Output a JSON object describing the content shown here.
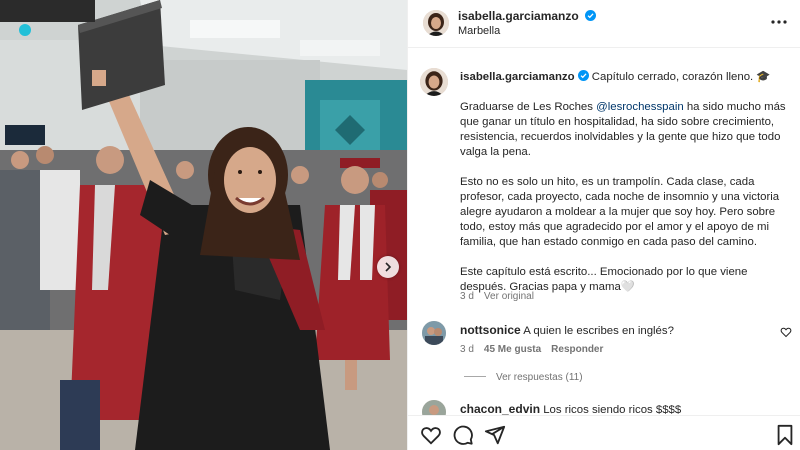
{
  "post": {
    "username": "isabella.garciamanzo",
    "location": "Marbella",
    "verified": true
  },
  "caption": {
    "username": "isabella.garciamanzo",
    "title_line": "Capítulo cerrado, corazón lleno. 🎓",
    "p1_before": "Graduarse de Les Roches ",
    "p1_mention": "@lesrochesspain",
    "p1_after": " ha sido mucho más que ganar un título en hospitalidad, ha sido sobre crecimiento, resistencia, recuerdos inolvidables y la gente que hizo que todo valga la pena.",
    "p2": "Esto no es solo un hito, es un trampolín. Cada clase, cada profesor, cada proyecto, cada noche de insomnio y una victoria alegre ayudaron a moldear a la mujer que soy hoy. Pero sobre todo, estoy más que agradecido por el amor y el apoyo de mi familia, que han estado conmigo en cada paso del camino.",
    "p3": "Este capítulo está escrito... Emocionado por lo que viene después. Gracias papa y mama🤍",
    "time": "3 d",
    "translate": "Ver original"
  },
  "comments": [
    {
      "username": "nottsonice",
      "text": "A quien le escribes en inglés?",
      "time": "3 d",
      "likes": "45 Me gusta",
      "reply": "Responder",
      "view_replies": "Ver respuestas (11)"
    },
    {
      "username": "chacon_edvin",
      "text": "Los ricos siendo ricos $$$$"
    }
  ],
  "icons": {
    "verified": "verified-badge-icon",
    "more": "more-options-icon",
    "like": "heart-icon",
    "comment": "comment-icon",
    "share": "share-icon",
    "save": "bookmark-icon",
    "next": "chevron-right-icon"
  },
  "colors": {
    "verified": "#0095f6",
    "mention": "#00376b",
    "secondary_text": "#737373",
    "gown": "#1c1c1c",
    "gown_red": "#8f1d25"
  }
}
